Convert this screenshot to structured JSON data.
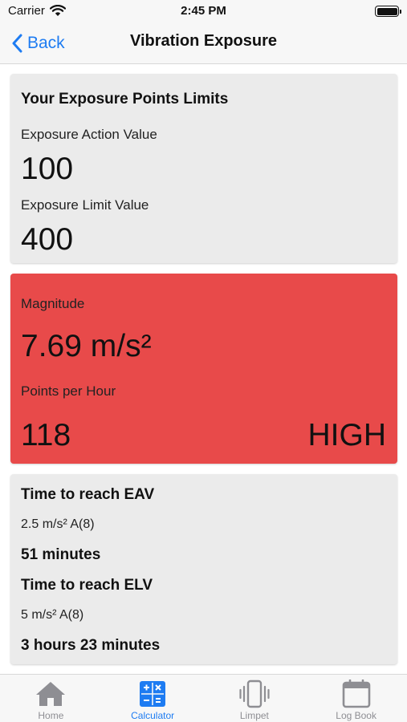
{
  "status_bar": {
    "carrier": "Carrier",
    "time": "2:45 PM"
  },
  "nav": {
    "back_label": "Back",
    "title": "Vibration Exposure"
  },
  "limits": {
    "heading": "Your Exposure Points Limits",
    "eav_label": "Exposure Action Value",
    "eav_value": "100",
    "elv_label": "Exposure Limit Value",
    "elv_value": "400"
  },
  "magnitude": {
    "label": "Magnitude",
    "value": "7.69 m/s²",
    "points_label": "Points per Hour",
    "points_value": "118",
    "level": "HIGH",
    "color": "#e84a4a"
  },
  "times": {
    "eav_heading": "Time to reach EAV",
    "eav_threshold": "2.5 m/s² A(8)",
    "eav_time": "51 minutes",
    "elv_heading": "Time to reach ELV",
    "elv_threshold": "5 m/s² A(8)",
    "elv_time": "3 hours 23 minutes"
  },
  "tabs": [
    {
      "label": "Home",
      "icon": "home-icon",
      "active": false
    },
    {
      "label": "Calculator",
      "icon": "calculator-icon",
      "active": true
    },
    {
      "label": "Limpet",
      "icon": "vibration-icon",
      "active": false
    },
    {
      "label": "Log Book",
      "icon": "calendar-icon",
      "active": false
    }
  ],
  "colors": {
    "accent": "#1e7cf2",
    "inactive": "#8e8e93",
    "card_bg": "#ebebeb"
  }
}
